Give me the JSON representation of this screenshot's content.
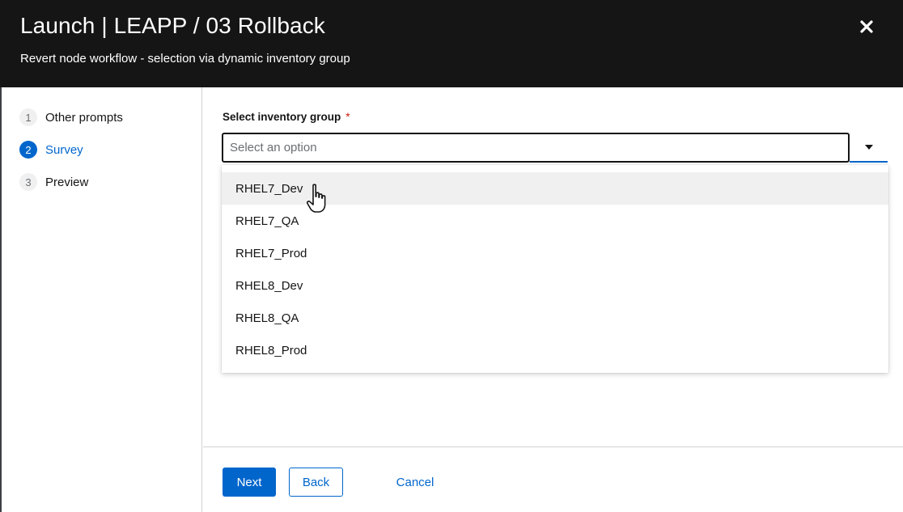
{
  "modal": {
    "title": "Launch | LEAPP / 03 Rollback",
    "subtitle": "Revert node workflow - selection via dynamic inventory group",
    "close_icon": "close-icon"
  },
  "wizard_nav": {
    "steps": [
      {
        "number": "1",
        "label": "Other prompts",
        "current": false
      },
      {
        "number": "2",
        "label": "Survey",
        "current": true
      },
      {
        "number": "3",
        "label": "Preview",
        "current": false
      }
    ]
  },
  "survey": {
    "field_label": "Select inventory group",
    "required_marker": "*",
    "select": {
      "placeholder": "Select an option",
      "value": "",
      "toggle_icon": "caret-down-icon"
    },
    "options": [
      "RHEL7_Dev",
      "RHEL7_QA",
      "RHEL7_Prod",
      "RHEL8_Dev",
      "RHEL8_QA",
      "RHEL8_Prod"
    ],
    "hovered_option": "RHEL7_Dev"
  },
  "footer": {
    "next_label": "Next",
    "back_label": "Back",
    "cancel_label": "Cancel"
  },
  "colors": {
    "header_bg": "#151515",
    "primary": "#0066cc",
    "required": "#c9190b",
    "hover_bg": "#f0f0f0"
  }
}
